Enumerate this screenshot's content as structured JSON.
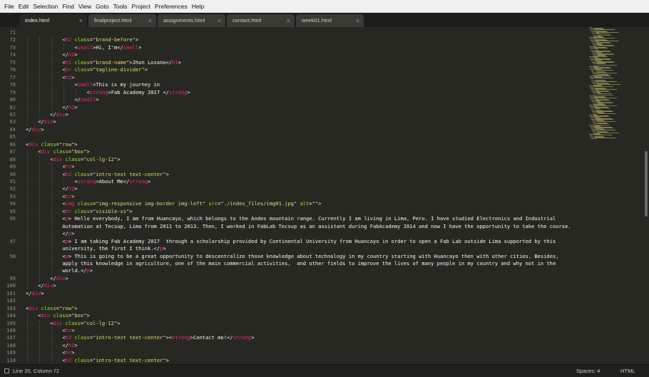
{
  "menu": [
    "File",
    "Edit",
    "Selection",
    "Find",
    "View",
    "Goto",
    "Tools",
    "Project",
    "Preferences",
    "Help"
  ],
  "tabs": [
    {
      "label": "index.html",
      "active": true
    },
    {
      "label": "finalproject.html",
      "active": false
    },
    {
      "label": "assignments.html",
      "active": false
    },
    {
      "label": "contact.html",
      "active": false
    },
    {
      "label": "week01.html",
      "active": false
    }
  ],
  "tab_close_glyph": "×",
  "colors": {
    "background": "#272822",
    "tag": "#f92672",
    "attribute": "#a6e22e",
    "string": "#e6db74",
    "text": "#f8f8f2",
    "line_number": "#8f908a"
  },
  "editor": {
    "lines": [
      {
        "num": "71",
        "indent": 0,
        "segs": []
      },
      {
        "num": "72",
        "indent": 6,
        "segs": [
          [
            "p",
            "<"
          ],
          [
            "t",
            "h2"
          ],
          [
            "p",
            " "
          ],
          [
            "a",
            "class"
          ],
          [
            "p",
            "="
          ],
          [
            "s",
            "\"brand-before\""
          ],
          [
            "p",
            ">"
          ]
        ]
      },
      {
        "num": "73",
        "indent": 8,
        "segs": [
          [
            "p",
            "<"
          ],
          [
            "t",
            "small"
          ],
          [
            "p",
            ">Hi, I'm</"
          ],
          [
            "t",
            "small"
          ],
          [
            "p",
            ">"
          ]
        ]
      },
      {
        "num": "74",
        "indent": 6,
        "segs": [
          [
            "p",
            "</"
          ],
          [
            "t",
            "h2"
          ],
          [
            "p",
            ">"
          ]
        ]
      },
      {
        "num": "75",
        "indent": 6,
        "segs": [
          [
            "p",
            "<"
          ],
          [
            "t",
            "h1"
          ],
          [
            "p",
            " "
          ],
          [
            "a",
            "class"
          ],
          [
            "p",
            "="
          ],
          [
            "s",
            "\"brand-name\""
          ],
          [
            "p",
            ">Jhon Lozano</"
          ],
          [
            "t",
            "h1"
          ],
          [
            "p",
            ">"
          ]
        ]
      },
      {
        "num": "76",
        "indent": 6,
        "segs": [
          [
            "p",
            "<"
          ],
          [
            "t",
            "hr"
          ],
          [
            "p",
            " "
          ],
          [
            "a",
            "class"
          ],
          [
            "p",
            "="
          ],
          [
            "s",
            "\"tagline-divider\""
          ],
          [
            "p",
            ">"
          ]
        ]
      },
      {
        "num": "77",
        "indent": 6,
        "segs": [
          [
            "p",
            "<"
          ],
          [
            "t",
            "h2"
          ],
          [
            "p",
            ">"
          ]
        ]
      },
      {
        "num": "78",
        "indent": 8,
        "segs": [
          [
            "p",
            "<"
          ],
          [
            "t",
            "small"
          ],
          [
            "p",
            ">This is my journey in"
          ]
        ]
      },
      {
        "num": "79",
        "indent": 10,
        "segs": [
          [
            "p",
            "<"
          ],
          [
            "t",
            "strong"
          ],
          [
            "p",
            ">Fab Academy 2017 </"
          ],
          [
            "t",
            "strong"
          ],
          [
            "p",
            ">"
          ]
        ]
      },
      {
        "num": "80",
        "indent": 8,
        "segs": [
          [
            "p",
            "</"
          ],
          [
            "t",
            "small"
          ],
          [
            "p",
            ">"
          ]
        ]
      },
      {
        "num": "81",
        "indent": 6,
        "segs": [
          [
            "p",
            "</"
          ],
          [
            "t",
            "h2"
          ],
          [
            "p",
            ">"
          ]
        ]
      },
      {
        "num": "82",
        "indent": 4,
        "segs": [
          [
            "p",
            "</"
          ],
          [
            "t",
            "div"
          ],
          [
            "p",
            ">"
          ]
        ]
      },
      {
        "num": "83",
        "indent": 2,
        "segs": [
          [
            "p",
            "</"
          ],
          [
            "t",
            "div"
          ],
          [
            "p",
            ">"
          ]
        ]
      },
      {
        "num": "84",
        "indent": 0,
        "segs": [
          [
            "p",
            "</"
          ],
          [
            "t",
            "div"
          ],
          [
            "p",
            ">"
          ]
        ]
      },
      {
        "num": "85",
        "indent": 0,
        "segs": []
      },
      {
        "num": "86",
        "indent": 0,
        "segs": [
          [
            "p",
            "<"
          ],
          [
            "t",
            "div"
          ],
          [
            "p",
            " "
          ],
          [
            "a",
            "class"
          ],
          [
            "p",
            "="
          ],
          [
            "s",
            "\"row\""
          ],
          [
            "p",
            ">"
          ]
        ]
      },
      {
        "num": "87",
        "indent": 2,
        "segs": [
          [
            "p",
            "<"
          ],
          [
            "t",
            "div"
          ],
          [
            "p",
            " "
          ],
          [
            "a",
            "class"
          ],
          [
            "p",
            "="
          ],
          [
            "s",
            "\"box\""
          ],
          [
            "p",
            ">"
          ]
        ]
      },
      {
        "num": "88",
        "indent": 4,
        "segs": [
          [
            "p",
            "<"
          ],
          [
            "t",
            "div"
          ],
          [
            "p",
            " "
          ],
          [
            "a",
            "class"
          ],
          [
            "p",
            "="
          ],
          [
            "s",
            "\"col-lg-12\""
          ],
          [
            "p",
            ">"
          ]
        ]
      },
      {
        "num": "89",
        "indent": 6,
        "segs": [
          [
            "p",
            "<"
          ],
          [
            "t",
            "hr"
          ],
          [
            "p",
            ">"
          ]
        ]
      },
      {
        "num": "90",
        "indent": 6,
        "segs": [
          [
            "p",
            "<"
          ],
          [
            "t",
            "h2"
          ],
          [
            "p",
            " "
          ],
          [
            "a",
            "class"
          ],
          [
            "p",
            "="
          ],
          [
            "s",
            "\"intro-text text-center\""
          ],
          [
            "p",
            ">"
          ]
        ]
      },
      {
        "num": "91",
        "indent": 8,
        "segs": [
          [
            "p",
            "<"
          ],
          [
            "t",
            "strong"
          ],
          [
            "p",
            ">About Me</"
          ],
          [
            "t",
            "strong"
          ],
          [
            "p",
            ">"
          ]
        ]
      },
      {
        "num": "92",
        "indent": 6,
        "segs": [
          [
            "p",
            "</"
          ],
          [
            "t",
            "h2"
          ],
          [
            "p",
            ">"
          ]
        ]
      },
      {
        "num": "93",
        "indent": 6,
        "segs": [
          [
            "p",
            "<"
          ],
          [
            "t",
            "hr"
          ],
          [
            "p",
            ">"
          ]
        ]
      },
      {
        "num": "94",
        "indent": 6,
        "segs": [
          [
            "p",
            "<"
          ],
          [
            "t",
            "img"
          ],
          [
            "p",
            " "
          ],
          [
            "a",
            "class"
          ],
          [
            "p",
            "="
          ],
          [
            "s",
            "\"img-responsive img-border img-left\""
          ],
          [
            "p",
            " "
          ],
          [
            "a",
            "src"
          ],
          [
            "p",
            "="
          ],
          [
            "s",
            "\"./index_files/img01.jpg\""
          ],
          [
            "p",
            " "
          ],
          [
            "a",
            "alt"
          ],
          [
            "p",
            "="
          ],
          [
            "s",
            "\"\""
          ],
          [
            "p",
            ">"
          ]
        ]
      },
      {
        "num": "95",
        "indent": 6,
        "segs": [
          [
            "p",
            "<"
          ],
          [
            "t",
            "hr"
          ],
          [
            "p",
            " "
          ],
          [
            "a",
            "class"
          ],
          [
            "p",
            "="
          ],
          [
            "s",
            "\"visible-xs\""
          ],
          [
            "p",
            ">"
          ]
        ]
      },
      {
        "num": "96",
        "indent": 6,
        "segs": [
          [
            "p",
            "<"
          ],
          [
            "t",
            "p"
          ],
          [
            "p",
            "> Hello everybody, I am from Huancayo, which belongs to the Andes mountain range. Currently I am living in Lima, Peru. I have studied Electronics and Industrial"
          ]
        ]
      },
      {
        "num": "",
        "indent": 6,
        "segs": [
          [
            "p",
            "Automation at Tecsup, Lima from 2011 to 2013. Then, I worked in FabLab Tecsup as an assistant during FabAcademy 2014 and now I have the opportunity to take the course."
          ]
        ]
      },
      {
        "num": "",
        "indent": 6,
        "segs": [
          [
            "p",
            "</"
          ],
          [
            "t",
            "p"
          ],
          [
            "p",
            ">"
          ]
        ]
      },
      {
        "num": "97",
        "indent": 6,
        "segs": [
          [
            "p",
            "<"
          ],
          [
            "t",
            "p"
          ],
          [
            "p",
            "> I am taking Fab Academy 2017  through a scholarship provided by Continental University from Huancayo in order to open a Fab Lab outside Lima supported by this"
          ]
        ]
      },
      {
        "num": "",
        "indent": 6,
        "segs": [
          [
            "p",
            "university, the first I think.</"
          ],
          [
            "t",
            "p"
          ],
          [
            "p",
            ">"
          ]
        ]
      },
      {
        "num": "98",
        "indent": 6,
        "segs": [
          [
            "p",
            "<"
          ],
          [
            "t",
            "p"
          ],
          [
            "p",
            "> This is going to be a great opportunity to descentralize those knowledge about technology in my country starting with Huancayo then with other cities. Besides,"
          ]
        ]
      },
      {
        "num": "",
        "indent": 6,
        "segs": [
          [
            "p",
            "apply this knowledge in agriculture, one of the main commercial activities,  and other fields to improve the lives of many people in my country and why not in the"
          ]
        ]
      },
      {
        "num": "",
        "indent": 6,
        "segs": [
          [
            "p",
            "world.</"
          ],
          [
            "t",
            "p"
          ],
          [
            "p",
            ">"
          ]
        ]
      },
      {
        "num": "99",
        "indent": 4,
        "segs": [
          [
            "p",
            "</"
          ],
          [
            "t",
            "div"
          ],
          [
            "p",
            ">"
          ]
        ]
      },
      {
        "num": "100",
        "indent": 2,
        "segs": [
          [
            "p",
            "</"
          ],
          [
            "t",
            "div"
          ],
          [
            "p",
            ">"
          ]
        ]
      },
      {
        "num": "101",
        "indent": 0,
        "segs": [
          [
            "p",
            "</"
          ],
          [
            "t",
            "div"
          ],
          [
            "p",
            ">"
          ]
        ]
      },
      {
        "num": "102",
        "indent": 0,
        "segs": []
      },
      {
        "num": "103",
        "indent": 0,
        "segs": [
          [
            "p",
            "<"
          ],
          [
            "t",
            "div"
          ],
          [
            "p",
            " "
          ],
          [
            "a",
            "class"
          ],
          [
            "p",
            "="
          ],
          [
            "s",
            "\"row\""
          ],
          [
            "p",
            ">"
          ]
        ]
      },
      {
        "num": "104",
        "indent": 2,
        "segs": [
          [
            "p",
            "<"
          ],
          [
            "t",
            "div"
          ],
          [
            "p",
            " "
          ],
          [
            "a",
            "class"
          ],
          [
            "p",
            "="
          ],
          [
            "s",
            "\"box\""
          ],
          [
            "p",
            ">"
          ]
        ]
      },
      {
        "num": "105",
        "indent": 4,
        "segs": [
          [
            "p",
            "<"
          ],
          [
            "t",
            "div"
          ],
          [
            "p",
            " "
          ],
          [
            "a",
            "class"
          ],
          [
            "p",
            "="
          ],
          [
            "s",
            "\"col-lg-12\""
          ],
          [
            "p",
            ">"
          ]
        ]
      },
      {
        "num": "106",
        "indent": 6,
        "segs": [
          [
            "p",
            "<"
          ],
          [
            "t",
            "hr"
          ],
          [
            "p",
            ">"
          ]
        ]
      },
      {
        "num": "107",
        "indent": 6,
        "segs": [
          [
            "p",
            "<"
          ],
          [
            "t",
            "h2"
          ],
          [
            "p",
            " "
          ],
          [
            "a",
            "class"
          ],
          [
            "p",
            "="
          ],
          [
            "s",
            "\"intro-text text-center\""
          ],
          [
            "p",
            "><"
          ],
          [
            "t",
            "strong"
          ],
          [
            "p",
            ">Contact me!</"
          ],
          [
            "t",
            "strong"
          ],
          [
            "p",
            ">"
          ]
        ]
      },
      {
        "num": "108",
        "indent": 6,
        "segs": [
          [
            "p",
            "</"
          ],
          [
            "t",
            "h2"
          ],
          [
            "p",
            ">"
          ]
        ]
      },
      {
        "num": "109",
        "indent": 6,
        "segs": [
          [
            "p",
            "<"
          ],
          [
            "t",
            "hr"
          ],
          [
            "p",
            ">"
          ]
        ]
      },
      {
        "num": "110",
        "indent": 6,
        "segs": [
          [
            "p",
            "<"
          ],
          [
            "t",
            "h2"
          ],
          [
            "p",
            " "
          ],
          [
            "a",
            "class"
          ],
          [
            "p",
            "="
          ],
          [
            "s",
            "\"intro-text text-center\""
          ],
          [
            "p",
            ">"
          ]
        ]
      }
    ]
  },
  "status": {
    "position": "Line 20, Column 72",
    "spaces": "Spaces: 4",
    "syntax": "HTML"
  }
}
